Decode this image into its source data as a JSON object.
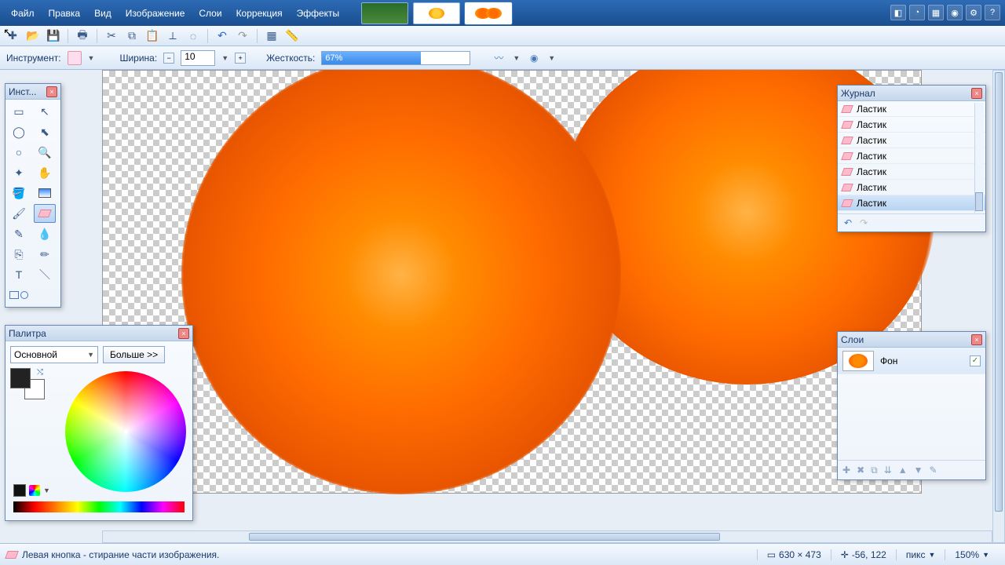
{
  "menus": {
    "file": "Файл",
    "edit": "Правка",
    "view": "Вид",
    "image": "Изображение",
    "layers": "Слои",
    "adjust": "Коррекция",
    "effects": "Эффекты"
  },
  "optbar": {
    "tool_label": "Инструмент:",
    "width_label": "Ширина:",
    "width_value": "10",
    "hardness_label": "Жесткость:",
    "hardness_value": "67%",
    "hardness_pct": 67
  },
  "panels": {
    "tools_title": "Инст...",
    "palette_title": "Палитра",
    "history_title": "Журнал",
    "layers_title": "Слои",
    "palette_mode": "Основной",
    "palette_more": "Больше >>"
  },
  "history": {
    "items": [
      "Ластик",
      "Ластик",
      "Ластик",
      "Ластик",
      "Ластик",
      "Ластик",
      "Ластик"
    ],
    "selected": 6
  },
  "layers": {
    "items": [
      {
        "name": "Фон",
        "visible": true
      }
    ]
  },
  "thumbs_active": 2,
  "status": {
    "hint": "Левая кнопка - стирание части изображения.",
    "dims": "630 × 473",
    "coords": "-56, 122",
    "unit": "пикс",
    "zoom": "150%"
  },
  "colors": {
    "fg": "#222222",
    "bg": "#ffffff"
  }
}
